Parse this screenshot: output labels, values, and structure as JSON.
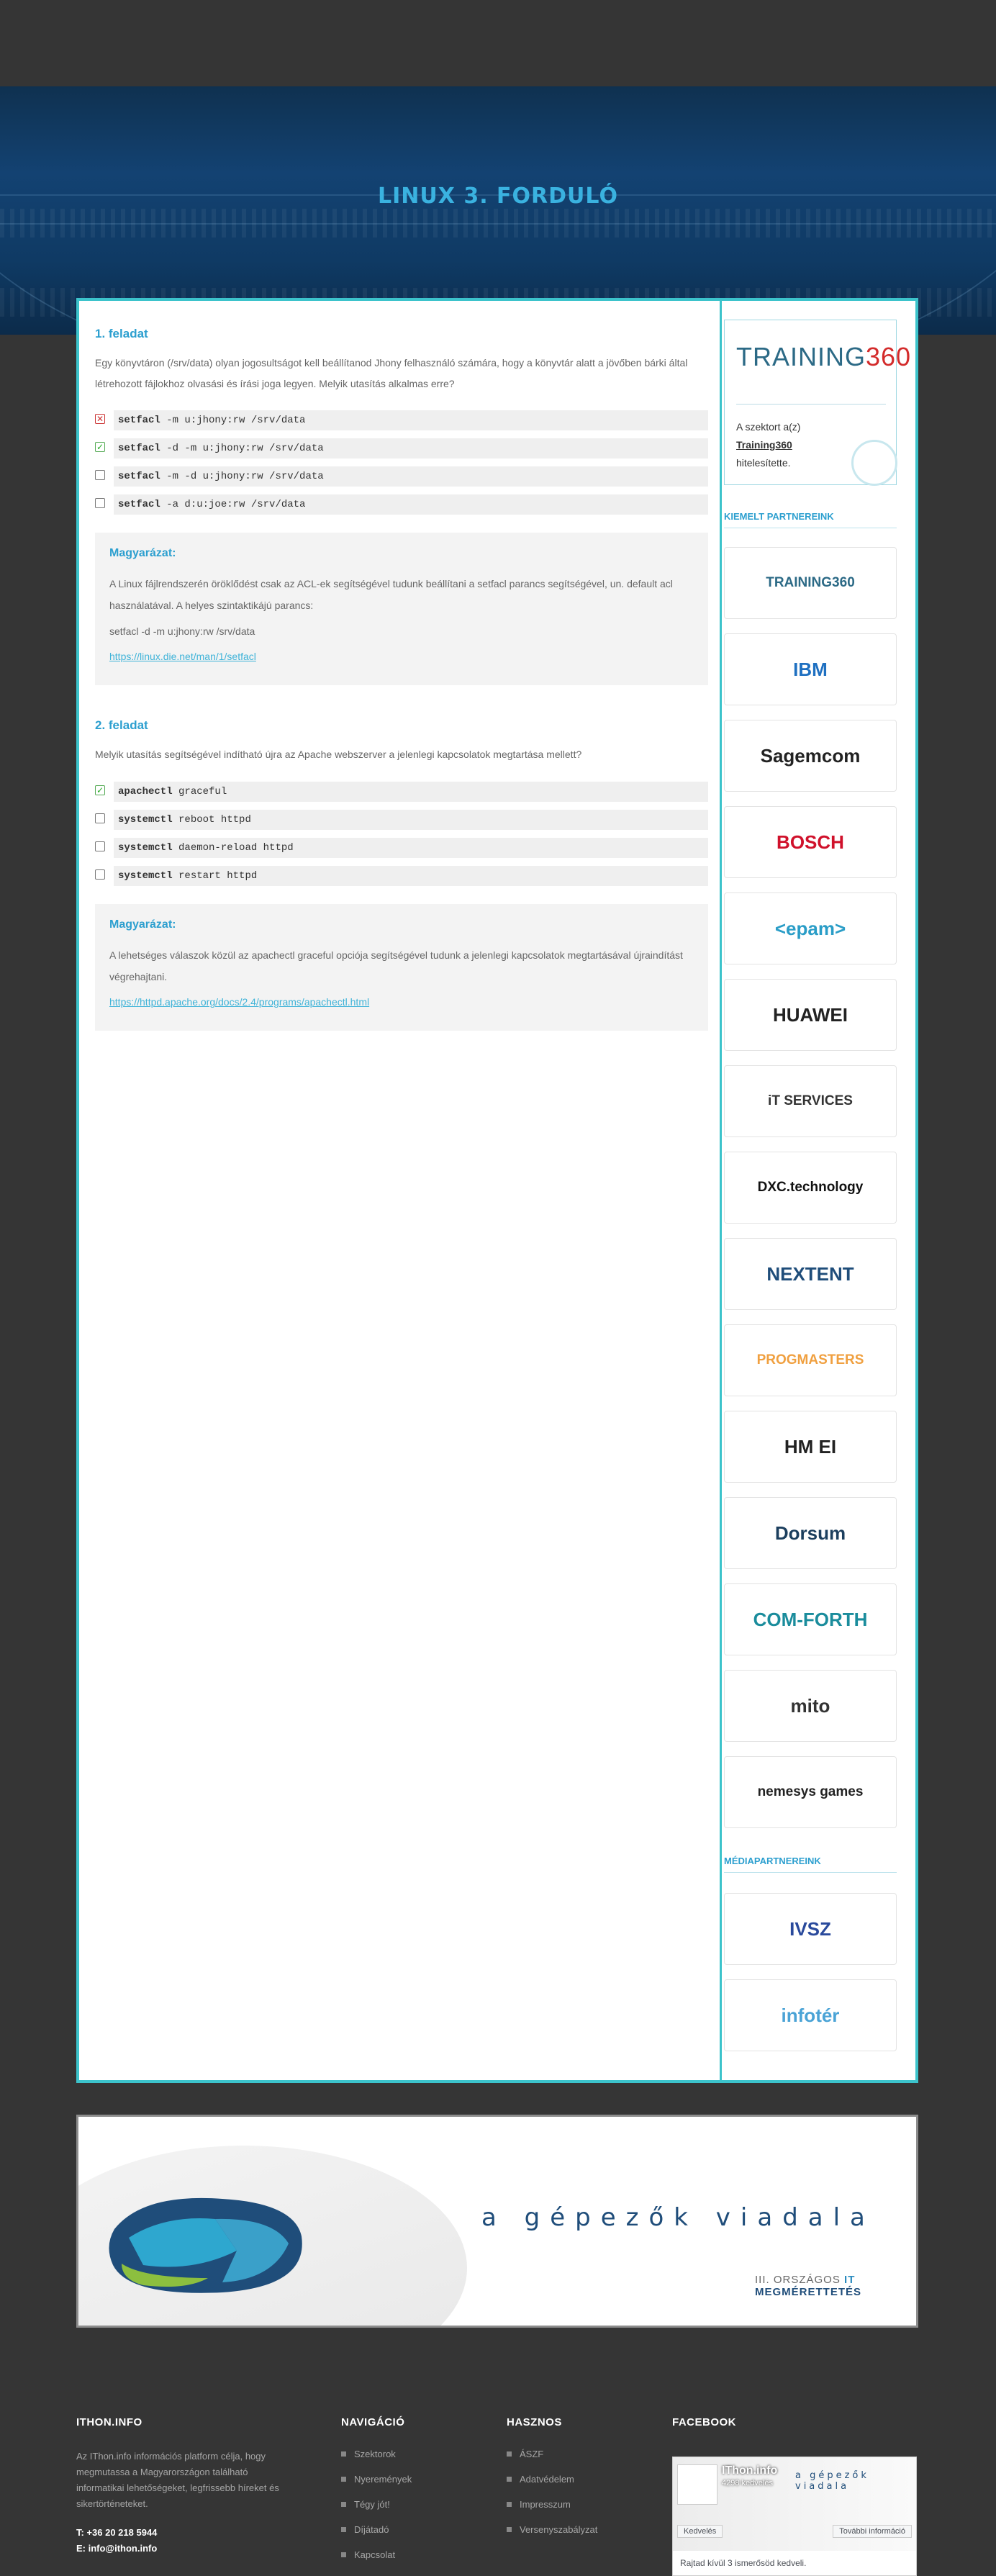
{
  "hero": {
    "title": "LINUX 3. FORDULÓ"
  },
  "questions": [
    {
      "title": "1. feladat",
      "text": "Egy könyvtáron (/srv/data) olyan jogosultságot kell beállítanod Jhony felhasználó számára, hogy a könyvtár alatt a jövőben bárki által létrehozott fájlokhoz olvasási és írási joga legyen. Melyik utasítás alkalmas erre?",
      "options": [
        {
          "cmd": "setfacl",
          "args": " -m u:jhony:rw /srv/data",
          "state": "wrong"
        },
        {
          "cmd": "setfacl",
          "args": " -d -m u:jhony:rw /srv/data",
          "state": "right"
        },
        {
          "cmd": "setfacl",
          "args": " -m -d u:jhony:rw /srv/data",
          "state": "none"
        },
        {
          "cmd": "setfacl",
          "args": " -a d:u:joe:rw /srv/data",
          "state": "none"
        }
      ],
      "explanation": {
        "heading": "Magyarázat:",
        "text": "A Linux fájlrendszerén öröklődést csak az ACL-ek segítségével tudunk beállítani a setfacl parancs segítségével, un. default acl használatával. A helyes szintaktikájú parancs:",
        "code": "setfacl -d -m u:jhony:rw /srv/data",
        "link": "https://linux.die.net/man/1/setfacl"
      }
    },
    {
      "title": "2. feladat",
      "text": "Melyik utasítás segítségével indítható újra az Apache webszerver a jelenlegi kapcsolatok megtartása mellett?",
      "options": [
        {
          "cmd": "apachectl",
          "args": " graceful",
          "state": "right"
        },
        {
          "cmd": "systemctl",
          "args": " reboot httpd",
          "state": "none"
        },
        {
          "cmd": "systemctl",
          "args": " daemon-reload httpd",
          "state": "none"
        },
        {
          "cmd": "systemctl",
          "args": " restart httpd",
          "state": "none"
        }
      ],
      "explanation": {
        "heading": "Magyarázat:",
        "text": "A lehetséges válaszok közül az apachectl graceful opciója segítségével tudunk a jelenlegi kapcsolatok megtartásával újraindítást végrehajtani.",
        "link": "https://httpd.apache.org/docs/2.4/programs/apachectl.html"
      }
    }
  ],
  "sidebar": {
    "cert": {
      "logo_main": "TRAINING",
      "logo_num": "360",
      "line1": "A szektort a(z)",
      "sponsor": "Training360",
      "line3": "hitelesítette."
    },
    "partners_heading": "KIEMELT PARTNEREINK",
    "partners": [
      {
        "name": "TRAINING360",
        "color": "#2c6a86",
        "icon": "training360-logo"
      },
      {
        "name": "IBM",
        "color": "#1f70c1",
        "icon": "ibm-logo"
      },
      {
        "name": "Sagemcom",
        "color": "#222222",
        "icon": "sagemcom-logo"
      },
      {
        "name": "BOSCH",
        "color": "#d0112b",
        "icon": "bosch-logo"
      },
      {
        "name": "<epam>",
        "color": "#2a9dc7",
        "icon": "epam-logo"
      },
      {
        "name": "HUAWEI",
        "color": "#222222",
        "icon": "huawei-logo"
      },
      {
        "name": "iT SERVICES",
        "color": "#333333",
        "icon": "it-services-logo"
      },
      {
        "name": "DXC.technology",
        "color": "#111111",
        "icon": "dxc-logo"
      },
      {
        "name": "NEXTENT",
        "color": "#1f4d7a",
        "icon": "nextent-logo"
      },
      {
        "name": "PROGMASTERS",
        "color": "#f0a040",
        "icon": "progmasters-logo"
      },
      {
        "name": "HM EI",
        "color": "#222222",
        "icon": "hm-ei-logo"
      },
      {
        "name": "Dorsum",
        "color": "#1c3f5e",
        "icon": "dorsum-logo"
      },
      {
        "name": "COM-FORTH",
        "color": "#1a8c9c",
        "icon": "com-forth-logo"
      },
      {
        "name": "mito",
        "color": "#333333",
        "icon": "mito-logo"
      },
      {
        "name": "nemesys games",
        "color": "#222222",
        "icon": "nemesys-logo"
      }
    ],
    "media_heading": "MÉDIAPARTNEREINK",
    "media": [
      {
        "name": "IVSZ",
        "color": "#2a4a9c",
        "icon": "ivsz-logo"
      },
      {
        "name": "infotér",
        "color": "#4aa3d6",
        "icon": "infoter-logo"
      }
    ]
  },
  "banner": {
    "slogan": "a gépezők viadala",
    "brand_line1": "III. ORSZÁGOS",
    "brand_it": "IT",
    "brand_line2": "MEGMÉRETTETÉS"
  },
  "footer": {
    "about": {
      "title": "ITHON.INFO",
      "text": "Az IThon.info információs platform célja, hogy megmutassa a Magyarországon található informatikai lehetőségeket, legfrissebb híreket és sikertörténeteket.",
      "phone": "T: +36 20 218 5944",
      "email": "E: info@ithon.info"
    },
    "nav": {
      "title": "NAVIGÁCIÓ",
      "items": [
        "Szektorok",
        "Nyeremények",
        "Tégy jót!",
        "Díjátadó",
        "Kapcsolat"
      ]
    },
    "useful": {
      "title": "HASZNOS",
      "items": [
        "ÁSZF",
        "Adatvédelem",
        "Impresszum",
        "Versenyszabályzat"
      ]
    },
    "facebook": {
      "title": "FACEBOOK",
      "page_name": "IThon.info",
      "followers": "4298 kedvelés",
      "like": "Kedvelés",
      "more": "További információ",
      "friends": "Rajtad kívül 3 ismerősöd kedveli."
    }
  }
}
